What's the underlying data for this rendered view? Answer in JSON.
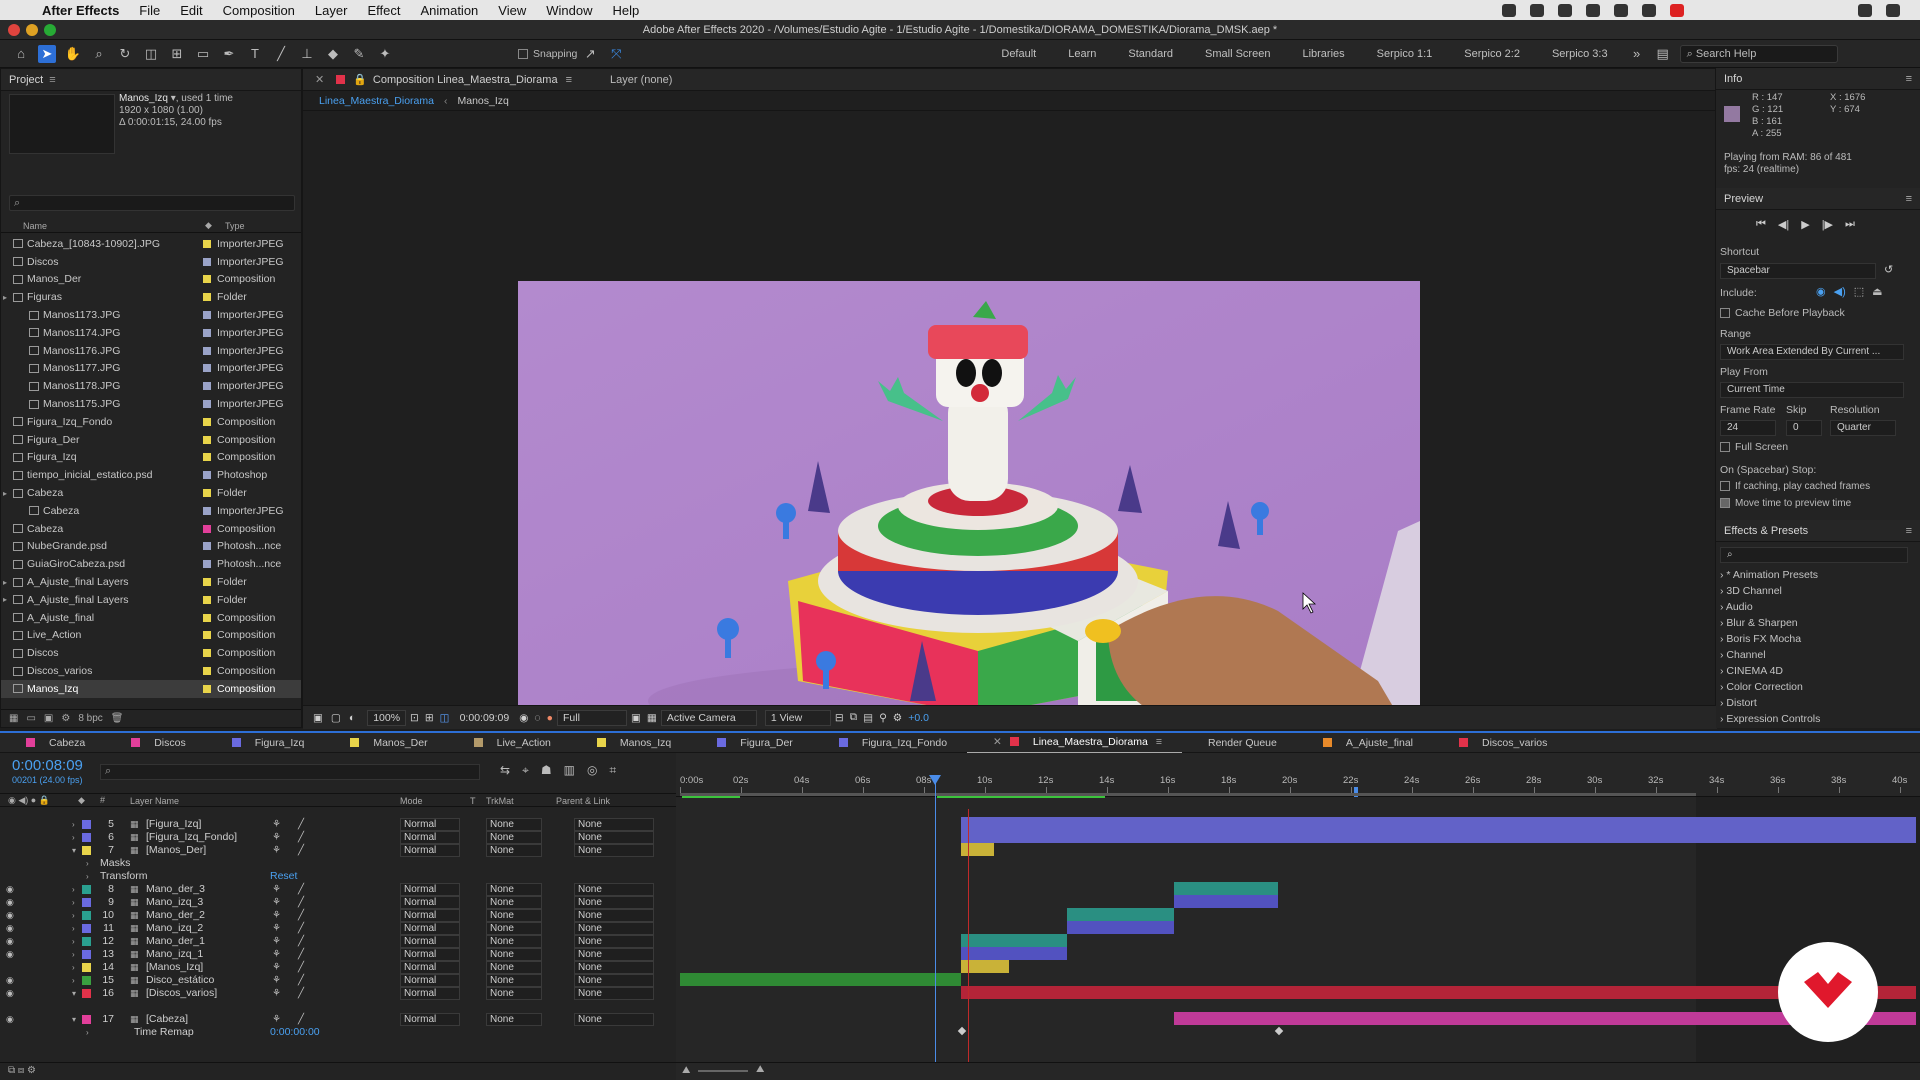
{
  "menubar": {
    "app": "After Effects",
    "items": [
      "File",
      "Edit",
      "Composition",
      "Layer",
      "Effect",
      "Animation",
      "View",
      "Window",
      "Help"
    ]
  },
  "titlebar": {
    "text": "Adobe After Effects 2020 - /Volumes/Estudio Agite - 1/Estudio Agite - 1/Domestika/DIORAMA_DOMESTIKA/Diorama_DMSK.aep *"
  },
  "toolbar": {
    "snapping": "Snapping",
    "workspaces": [
      "Default",
      "Learn",
      "Standard",
      "Small Screen",
      "Libraries",
      "Serpico 1:1",
      "Serpico 2:2",
      "Serpico 3:3"
    ],
    "search_placeholder": "Search Help"
  },
  "project": {
    "title": "Project",
    "selected_name": "Manos_Izq",
    "used": ", used 1 time",
    "dims": "1920 x 1080 (1.00)",
    "duration": "Δ 0:00:01:15, 24.00 fps",
    "col_name": "Name",
    "col_type": "Type",
    "bpc": "8 bpc",
    "items": [
      {
        "name": "Cabeza_[10843-10902].JPG",
        "type": "ImporterJPEG",
        "color": "#e8d44a",
        "indent": 0,
        "folder": false
      },
      {
        "name": "Discos",
        "type": "ImporterJPEG",
        "color": "#9aa3c8",
        "indent": 0,
        "folder": false
      },
      {
        "name": "Manos_Der",
        "type": "Composition",
        "color": "#e8d44a",
        "indent": 0,
        "folder": false
      },
      {
        "name": "Figuras",
        "type": "Folder",
        "color": "#e8d44a",
        "indent": 0,
        "folder": true
      },
      {
        "name": "Manos1173.JPG",
        "type": "ImporterJPEG",
        "color": "#9aa3c8",
        "indent": 1,
        "folder": false
      },
      {
        "name": "Manos1174.JPG",
        "type": "ImporterJPEG",
        "color": "#9aa3c8",
        "indent": 1,
        "folder": false
      },
      {
        "name": "Manos1176.JPG",
        "type": "ImporterJPEG",
        "color": "#9aa3c8",
        "indent": 1,
        "folder": false
      },
      {
        "name": "Manos1177.JPG",
        "type": "ImporterJPEG",
        "color": "#9aa3c8",
        "indent": 1,
        "folder": false
      },
      {
        "name": "Manos1178.JPG",
        "type": "ImporterJPEG",
        "color": "#9aa3c8",
        "indent": 1,
        "folder": false
      },
      {
        "name": "Manos1175.JPG",
        "type": "ImporterJPEG",
        "color": "#9aa3c8",
        "indent": 1,
        "folder": false
      },
      {
        "name": "Figura_Izq_Fondo",
        "type": "Composition",
        "color": "#e8d44a",
        "indent": 0,
        "folder": false
      },
      {
        "name": "Figura_Der",
        "type": "Composition",
        "color": "#e8d44a",
        "indent": 0,
        "folder": false
      },
      {
        "name": "Figura_Izq",
        "type": "Composition",
        "color": "#e8d44a",
        "indent": 0,
        "folder": false
      },
      {
        "name": "tiempo_inicial_estatico.psd",
        "type": "Photoshop",
        "color": "#9aa3c8",
        "indent": 0,
        "folder": false
      },
      {
        "name": "Cabeza",
        "type": "Folder",
        "color": "#e8d44a",
        "indent": 0,
        "folder": true
      },
      {
        "name": "Cabeza",
        "type": "ImporterJPEG",
        "color": "#9aa3c8",
        "indent": 1,
        "folder": false
      },
      {
        "name": "Cabeza",
        "type": "Composition",
        "color": "#e23f9a",
        "indent": 0,
        "folder": false
      },
      {
        "name": "NubeGrande.psd",
        "type": "Photosh...nce",
        "color": "#9aa3c8",
        "indent": 0,
        "folder": false
      },
      {
        "name": "GuiaGiroCabeza.psd",
        "type": "Photosh...nce",
        "color": "#9aa3c8",
        "indent": 0,
        "folder": false
      },
      {
        "name": "A_Ajuste_final Layers",
        "type": "Folder",
        "color": "#e8d44a",
        "indent": 0,
        "folder": true
      },
      {
        "name": "A_Ajuste_final Layers",
        "type": "Folder",
        "color": "#e8d44a",
        "indent": 0,
        "folder": true
      },
      {
        "name": "A_Ajuste_final",
        "type": "Composition",
        "color": "#e8d44a",
        "indent": 0,
        "folder": false
      },
      {
        "name": "Live_Action",
        "type": "Composition",
        "color": "#e8d44a",
        "indent": 0,
        "folder": false
      },
      {
        "name": "Discos",
        "type": "Composition",
        "color": "#e8d44a",
        "indent": 0,
        "folder": false
      },
      {
        "name": "Discos_varios",
        "type": "Composition",
        "color": "#e8d44a",
        "indent": 0,
        "folder": false
      },
      {
        "name": "Manos_Izq",
        "type": "Composition",
        "color": "#e8d44a",
        "indent": 0,
        "folder": false,
        "selected": true
      }
    ]
  },
  "viewer": {
    "tab": "Composition Linea_Maestra_Diorama",
    "layer_tab": "Layer (none)",
    "crumbs": [
      "Linea_Maestra_Diorama",
      "Manos_Izq"
    ],
    "zoom": "100%",
    "timecode": "0:00:09:09",
    "resolution": "Full",
    "camera": "Active Camera",
    "view": "1 View",
    "exposure": "+0.0"
  },
  "info": {
    "title": "Info",
    "rgba": [
      "R : 147",
      "G : 121",
      "B : 161",
      "A : 255"
    ],
    "xy": [
      "X : 1676",
      "Y : 674"
    ],
    "swatch": "#9379a1",
    "ram": "Playing from RAM: 86 of 481",
    "fps": "fps: 24 (realtime)"
  },
  "preview": {
    "title": "Preview",
    "shortcut_label": "Shortcut",
    "shortcut": "Spacebar",
    "include": "Include:",
    "cache": "Cache Before Playback",
    "range_label": "Range",
    "range": "Work Area Extended By Current ...",
    "playfrom_label": "Play From",
    "playfrom": "Current Time",
    "fr_label": "Frame Rate",
    "skip_label": "Skip",
    "res_label": "Resolution",
    "fr": "24",
    "skip": "0",
    "res": "Quarter",
    "fullscreen": "Full Screen",
    "stop_label": "On (Spacebar) Stop:",
    "opt1": "If caching, play cached frames",
    "opt2": "Move time to preview time"
  },
  "effects": {
    "title": "Effects & Presets",
    "items": [
      "* Animation Presets",
      "3D Channel",
      "Audio",
      "Blur & Sharpen",
      "Boris FX Mocha",
      "Channel",
      "CINEMA 4D",
      "Color Correction",
      "Distort",
      "Expression Controls"
    ]
  },
  "timeline": {
    "tabs": [
      {
        "name": "Cabeza",
        "color": "#e23f9a"
      },
      {
        "name": "Discos",
        "color": "#e23f9a"
      },
      {
        "name": "Figura_Izq",
        "color": "#6a6ae0"
      },
      {
        "name": "Manos_Der",
        "color": "#e8d44a"
      },
      {
        "name": "Live_Action",
        "color": "#b39a6a"
      },
      {
        "name": "Manos_Izq",
        "color": "#e8d44a"
      },
      {
        "name": "Figura_Der",
        "color": "#6a6ae0"
      },
      {
        "name": "Figura_Izq_Fondo",
        "color": "#6a6ae0"
      },
      {
        "name": "Linea_Maestra_Diorama",
        "color": "#e2324a",
        "active": true
      },
      {
        "name": "Render Queue",
        "color": ""
      },
      {
        "name": "A_Ajuste_final",
        "color": "#e88a2a"
      },
      {
        "name": "Discos_varios",
        "color": "#e2324a"
      }
    ],
    "timecode": "0:00:08:09",
    "frames": "00201 (24.00 fps)",
    "col_layer": "Layer Name",
    "col_mode": "Mode",
    "col_t": "T",
    "col_trk": "TrkMat",
    "col_parent": "Parent & Link",
    "ticks": [
      "0:00s",
      "02s",
      "04s",
      "06s",
      "08s",
      "10s",
      "12s",
      "14s",
      "16s",
      "18s",
      "20s",
      "22s",
      "24s",
      "26s",
      "28s",
      "30s",
      "32s",
      "34s",
      "36s",
      "38s",
      "40s"
    ],
    "masks": "Masks",
    "transform": "Transform",
    "reset": "Reset",
    "timeremap": "Time Remap",
    "timeremap_val": "0:00:00:00",
    "layers": [
      {
        "num": "5",
        "name": "[Figura_Izq]",
        "color": "#6a6ae0",
        "mode": "Normal",
        "trk": "None",
        "parent": "None",
        "eye": false
      },
      {
        "num": "6",
        "name": "[Figura_Izq_Fondo]",
        "color": "#6a6ae0",
        "mode": "Normal",
        "trk": "None",
        "parent": "None",
        "eye": false
      },
      {
        "num": "7",
        "name": "[Manos_Der]",
        "color": "#e8d44a",
        "mode": "Normal",
        "trk": "None",
        "parent": "None",
        "eye": false
      },
      {
        "num": "8",
        "name": "Mano_der_3",
        "color": "#2aa090",
        "mode": "Normal",
        "trk": "None",
        "parent": "None",
        "eye": true
      },
      {
        "num": "9",
        "name": "Mano_izq_3",
        "color": "#6a6ae0",
        "mode": "Normal",
        "trk": "None",
        "parent": "None",
        "eye": true
      },
      {
        "num": "10",
        "name": "Mano_der_2",
        "color": "#2aa090",
        "mode": "Normal",
        "trk": "None",
        "parent": "None",
        "eye": true
      },
      {
        "num": "11",
        "name": "Mano_izq_2",
        "color": "#6a6ae0",
        "mode": "Normal",
        "trk": "None",
        "parent": "None",
        "eye": true
      },
      {
        "num": "12",
        "name": "Mano_der_1",
        "color": "#2aa090",
        "mode": "Normal",
        "trk": "None",
        "parent": "None",
        "eye": true
      },
      {
        "num": "13",
        "name": "Mano_izq_1",
        "color": "#6a6ae0",
        "mode": "Normal",
        "trk": "None",
        "parent": "None",
        "eye": true
      },
      {
        "num": "14",
        "name": "[Manos_Izq]",
        "color": "#e8d44a",
        "mode": "Normal",
        "trk": "None",
        "parent": "None",
        "eye": false
      },
      {
        "num": "15",
        "name": "Disco_estático",
        "color": "#3aa040",
        "mode": "Normal",
        "trk": "None",
        "parent": "None",
        "eye": true
      },
      {
        "num": "16",
        "name": "[Discos_varios]",
        "color": "#e2324a",
        "mode": "Normal",
        "trk": "None",
        "parent": "None",
        "eye": true
      },
      {
        "num": "17",
        "name": "[Cabeza]",
        "color": "#e23f9a",
        "mode": "Normal",
        "trk": "None",
        "parent": "None",
        "eye": true
      }
    ]
  }
}
